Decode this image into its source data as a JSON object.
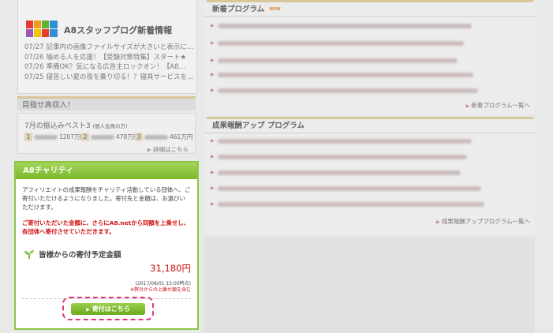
{
  "blog": {
    "title": "A8スタッフブログ新着情報",
    "logo_colors": [
      "#e63c2f",
      "#f39a1c",
      "#5db234",
      "#2f8fcf",
      "#9b59b6",
      "#f2c500",
      "#e63c2f",
      "#2f8fcf"
    ],
    "items": [
      {
        "date": "07/27",
        "text": "記事内の画像ファイルサイズが大きいと表示に…"
      },
      {
        "date": "07/26",
        "text": "噛める人を応援！【受験対策特集】スタート★"
      },
      {
        "date": "07/26",
        "text": "準備OK？気になる広告主ロックオン！【A8…"
      },
      {
        "date": "07/25",
        "text": "寝苦しい夏の夜を乗り切る！？寝具サービスを…"
      }
    ]
  },
  "earn": {
    "header": "目指せ高収入！",
    "subtitle_main": "7月の振込みベスト3",
    "subtitle_note": "(個人会員の方)",
    "ranks": [
      {
        "num": "1",
        "amount": "1207万円"
      },
      {
        "num": "2",
        "amount": "478万円"
      },
      {
        "num": "3",
        "amount": "461万円"
      }
    ],
    "more": "詳細はこちら"
  },
  "charity": {
    "header": "A8チャリティ",
    "description": "アフィリエイトの成果報酬をチャリティ活動している団体へ、ご寄付いただけるようになりました。寄付先と金額は、お選びいただけます。",
    "note": "ご寄付いただいた金額に、さらにA8.netから同額を上乗せし、各団体へ寄付させていただきます。",
    "donation_label": "皆様からの寄付予定金額",
    "donation_amount": "31,180円",
    "donation_date": "(2017/08/01 15:00時点)",
    "donation_note": "※弊社からの上乗せ額を含む",
    "button_label": "寄付はこちら"
  },
  "new_programs": {
    "title": "新着プログラム",
    "badge": "NEW",
    "more": "新着プログラム一覧へ"
  },
  "reward_programs": {
    "title": "成果報酬アップ プログラム",
    "more": "成果報酬アッププログラム一覧へ"
  }
}
